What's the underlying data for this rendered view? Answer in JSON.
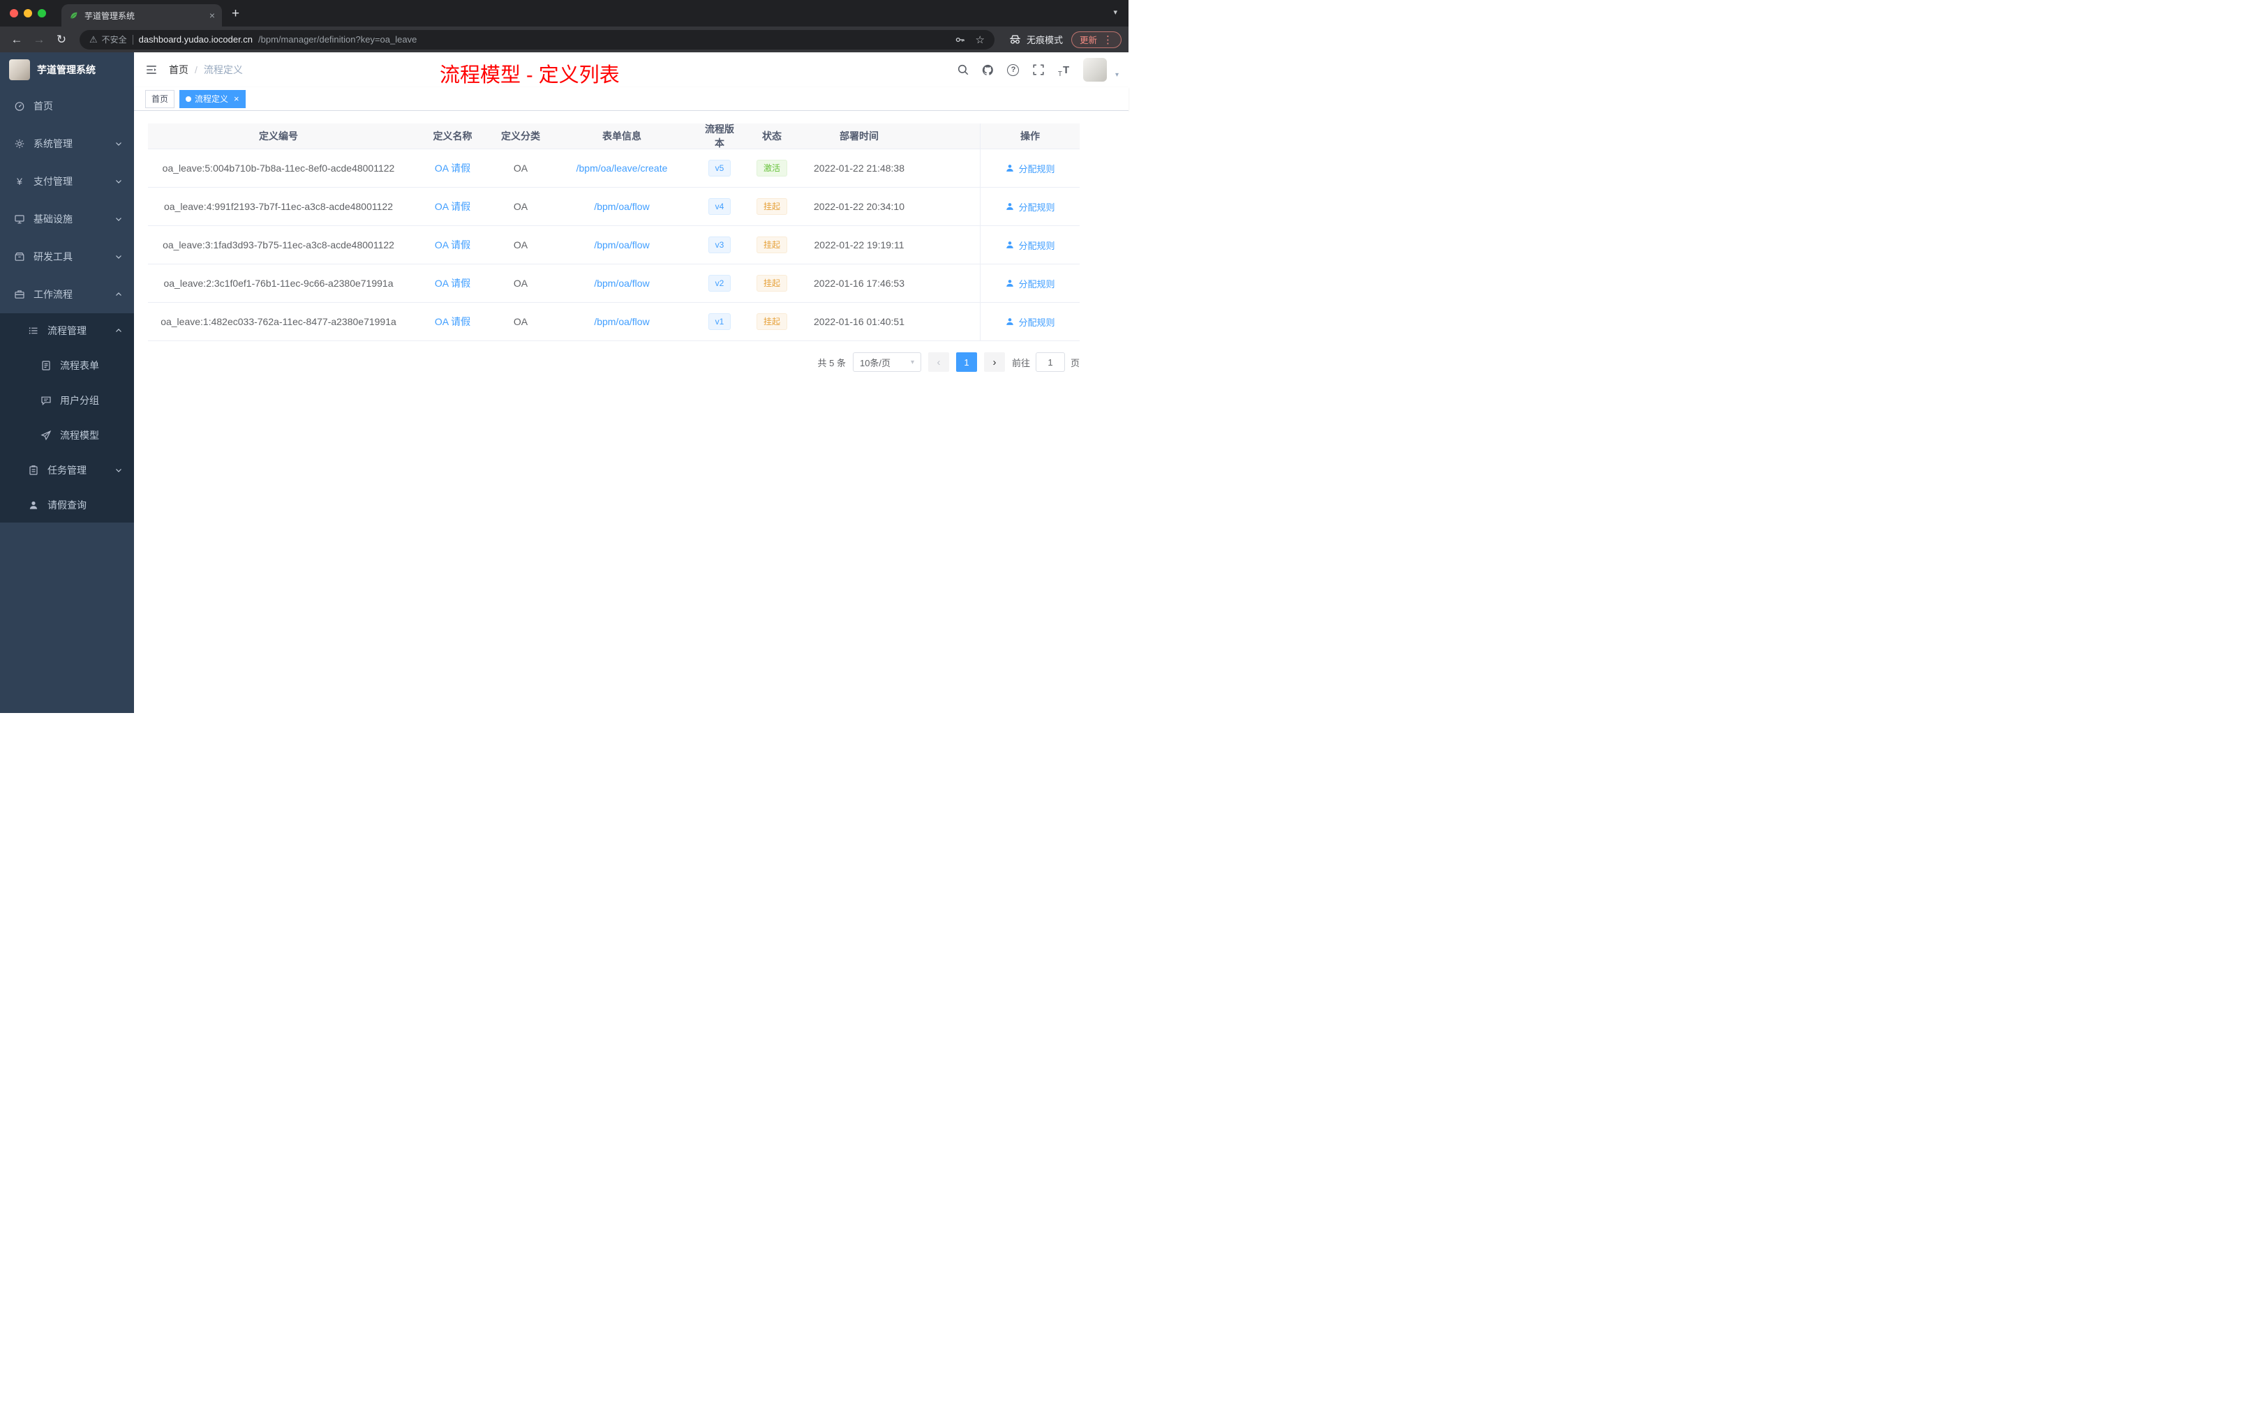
{
  "icons": {
    "close": "×",
    "new_tab": "+",
    "caret_down": "▾",
    "back": "←",
    "forward": "→",
    "reload": "↻",
    "warning": "⚠",
    "star": "☆",
    "dots": "⋮",
    "question": "?",
    "t_large": "T",
    "t_small": "T",
    "slash": "/",
    "prev": "‹",
    "next": "›",
    "yen": "¥"
  },
  "browser": {
    "tab_title": "芋道管理系统",
    "security_label": "不安全",
    "url_domain": "dashboard.yudao.iocoder.cn",
    "url_path": "/bpm/manager/definition?key=oa_leave",
    "incognito_label": "无痕模式",
    "update_label": "更新"
  },
  "sidebar": {
    "logo_title": "芋道管理系统",
    "items": [
      {
        "label": "首页"
      },
      {
        "label": "系统管理"
      },
      {
        "label": "支付管理"
      },
      {
        "label": "基础设施"
      },
      {
        "label": "研发工具"
      },
      {
        "label": "工作流程"
      },
      {
        "label": "流程管理"
      },
      {
        "label": "流程表单"
      },
      {
        "label": "用户分组"
      },
      {
        "label": "流程模型"
      },
      {
        "label": "任务管理"
      },
      {
        "label": "请假查询"
      }
    ]
  },
  "header": {
    "breadcrumb_home": "首页",
    "breadcrumb_current": "流程定义",
    "page_title": "流程模型 - 定义列表"
  },
  "tags": {
    "home": "首页",
    "current": "流程定义"
  },
  "table": {
    "columns": [
      "定义编号",
      "定义名称",
      "定义分类",
      "表单信息",
      "流程版本",
      "状态",
      "部署时间",
      "操作"
    ],
    "rows": [
      {
        "id": "oa_leave:5:004b710b-7b8a-11ec-8ef0-acde48001122",
        "name": "OA 请假",
        "category": "OA",
        "form": "/bpm/oa/leave/create",
        "version": "v5",
        "status": "激活",
        "status_type": "success",
        "time": "2022-01-22 21:48:38",
        "action": "分配规则"
      },
      {
        "id": "oa_leave:4:991f2193-7b7f-11ec-a3c8-acde48001122",
        "name": "OA 请假",
        "category": "OA",
        "form": "/bpm/oa/flow",
        "version": "v4",
        "status": "挂起",
        "status_type": "warning",
        "time": "2022-01-22 20:34:10",
        "action": "分配规则"
      },
      {
        "id": "oa_leave:3:1fad3d93-7b75-11ec-a3c8-acde48001122",
        "name": "OA 请假",
        "category": "OA",
        "form": "/bpm/oa/flow",
        "version": "v3",
        "status": "挂起",
        "status_type": "warning",
        "time": "2022-01-22 19:19:11",
        "action": "分配规则"
      },
      {
        "id": "oa_leave:2:3c1f0ef1-76b1-11ec-9c66-a2380e71991a",
        "name": "OA 请假",
        "category": "OA",
        "form": "/bpm/oa/flow",
        "version": "v2",
        "status": "挂起",
        "status_type": "warning",
        "time": "2022-01-16 17:46:53",
        "action": "分配规则"
      },
      {
        "id": "oa_leave:1:482ec033-762a-11ec-8477-a2380e71991a",
        "name": "OA 请假",
        "category": "OA",
        "form": "/bpm/oa/flow",
        "version": "v1",
        "status": "挂起",
        "status_type": "warning",
        "time": "2022-01-16 01:40:51",
        "action": "分配规则"
      }
    ]
  },
  "pagination": {
    "total": "共 5 条",
    "page_size": "10条/页",
    "current_page": "1",
    "goto_label": "前往",
    "goto_value": "1",
    "goto_suffix": "页"
  },
  "colors": {
    "accent": "#409eff",
    "success": "#67c23a",
    "warning": "#e6a23c",
    "title_red": "#ff0000",
    "sidebar_bg": "#304156",
    "submenu_bg": "#1f2d3d"
  }
}
